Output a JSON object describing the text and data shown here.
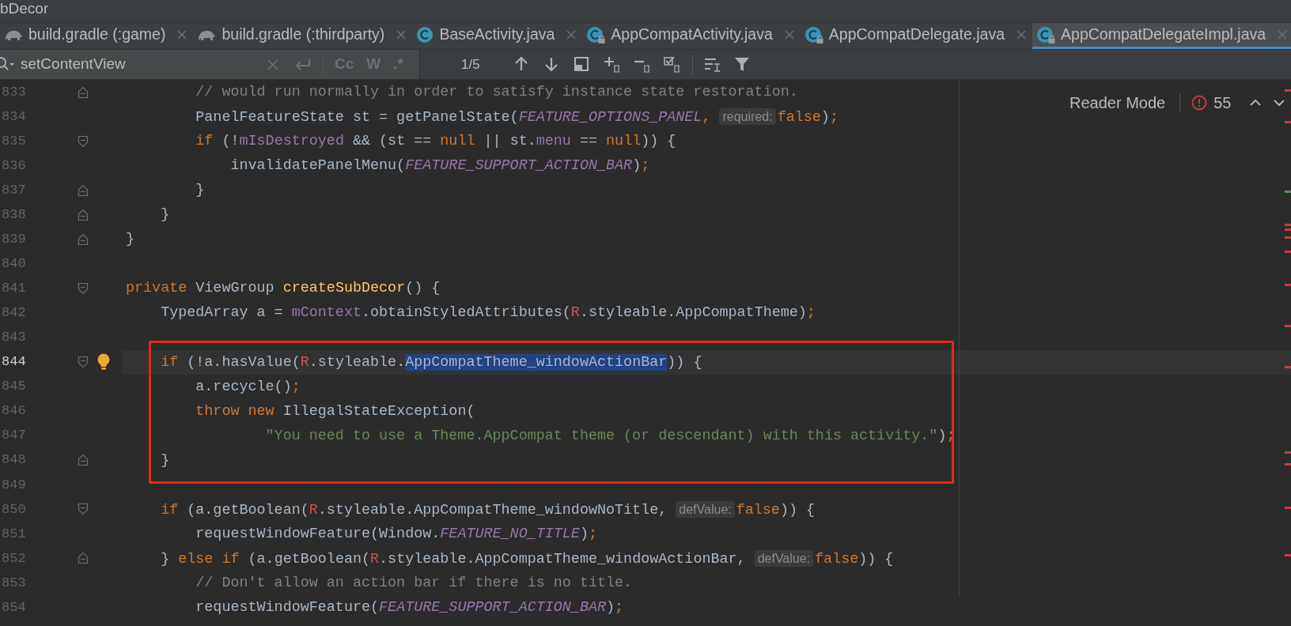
{
  "window": {
    "title": "bDecor"
  },
  "tabs": [
    {
      "label": "build.gradle (:game)",
      "kind": "gradle",
      "locked": false,
      "selected": false
    },
    {
      "label": "build.gradle (:thirdparty)",
      "kind": "gradle",
      "locked": false,
      "selected": false
    },
    {
      "label": "BaseActivity.java",
      "kind": "class",
      "locked": false,
      "selected": false
    },
    {
      "label": "AppCompatActivity.java",
      "kind": "class",
      "locked": true,
      "selected": false
    },
    {
      "label": "AppCompatDelegate.java",
      "kind": "class",
      "locked": true,
      "selected": false
    },
    {
      "label": "AppCompatDelegateImpl.java",
      "kind": "class",
      "locked": true,
      "selected": true
    }
  ],
  "search": {
    "value": "setContentView",
    "options": [
      "Cc",
      "W",
      ".*"
    ],
    "match_count": "1/5"
  },
  "reader_mode": {
    "label": "Reader Mode",
    "error_count": "55"
  },
  "editor": {
    "lines": [
      {
        "number": "833",
        "fold_start": false,
        "fold_end": true,
        "current": false,
        "bulb": false,
        "tokens": [
          {
            "kind": "comment",
            "text": "        // would run normally in order to satisfy instance state restoration."
          }
        ]
      },
      {
        "number": "834",
        "fold_start": false,
        "fold_end": false,
        "current": false,
        "bulb": false,
        "tokens": [
          {
            "kind": "plain",
            "text": "        PanelFeatureState st = getPanelState("
          },
          {
            "kind": "constant",
            "text": "FEATURE_OPTIONS_PANEL"
          },
          {
            "kind": "keyword",
            "text": ", "
          },
          {
            "kind": "hint",
            "text": "required:"
          },
          {
            "kind": "keyword",
            "text": "false"
          },
          {
            "kind": "plain",
            "text": ")"
          },
          {
            "kind": "keyword",
            "text": ";"
          }
        ]
      },
      {
        "number": "835",
        "fold_start": true,
        "fold_end": false,
        "current": false,
        "bulb": false,
        "tokens": [
          {
            "kind": "keyword",
            "text": "        if"
          },
          {
            "kind": "plain",
            "text": " (!"
          },
          {
            "kind": "field",
            "text": "mIsDestroyed"
          },
          {
            "kind": "plain",
            "text": " && (st == "
          },
          {
            "kind": "keyword",
            "text": "null"
          },
          {
            "kind": "plain",
            "text": " || st."
          },
          {
            "kind": "field",
            "text": "menu"
          },
          {
            "kind": "plain",
            "text": " == "
          },
          {
            "kind": "keyword",
            "text": "null"
          },
          {
            "kind": "plain",
            "text": ")) {"
          }
        ]
      },
      {
        "number": "836",
        "fold_start": false,
        "fold_end": false,
        "current": false,
        "bulb": false,
        "tokens": [
          {
            "kind": "plain",
            "text": "            invalidatePanelMenu("
          },
          {
            "kind": "constant",
            "text": "FEATURE_SUPPORT_ACTION_BAR"
          },
          {
            "kind": "plain",
            "text": ")"
          },
          {
            "kind": "keyword",
            "text": ";"
          }
        ]
      },
      {
        "number": "837",
        "fold_start": false,
        "fold_end": true,
        "current": false,
        "bulb": false,
        "tokens": [
          {
            "kind": "plain",
            "text": "        }"
          }
        ]
      },
      {
        "number": "838",
        "fold_start": false,
        "fold_end": true,
        "current": false,
        "bulb": false,
        "tokens": [
          {
            "kind": "plain",
            "text": "    }"
          }
        ]
      },
      {
        "number": "839",
        "fold_start": false,
        "fold_end": true,
        "current": false,
        "bulb": false,
        "tokens": [
          {
            "kind": "plain",
            "text": "}"
          }
        ]
      },
      {
        "number": "840",
        "fold_start": false,
        "fold_end": false,
        "current": false,
        "bulb": false
      },
      {
        "number": "841",
        "fold_start": true,
        "fold_end": false,
        "current": false,
        "bulb": false,
        "tokens": [
          {
            "kind": "keyword",
            "text": "private"
          },
          {
            "kind": "plain",
            "text": " ViewGroup "
          },
          {
            "kind": "method",
            "text": "createSubDecor"
          },
          {
            "kind": "plain",
            "text": "() {"
          }
        ]
      },
      {
        "number": "842",
        "fold_start": false,
        "fold_end": false,
        "current": false,
        "bulb": false,
        "tokens": [
          {
            "kind": "plain",
            "text": "    TypedArray a = "
          },
          {
            "kind": "field",
            "text": "mContext"
          },
          {
            "kind": "plain",
            "text": ".obtainStyledAttributes("
          },
          {
            "kind": "resource",
            "text": "R"
          },
          {
            "kind": "plain",
            "text": ".styleable.AppCompatTheme)"
          },
          {
            "kind": "keyword",
            "text": ";"
          }
        ]
      },
      {
        "number": "843",
        "fold_start": false,
        "fold_end": false,
        "current": false,
        "bulb": false
      },
      {
        "number": "844",
        "fold_start": true,
        "fold_end": false,
        "current": true,
        "bulb": true,
        "tokens": [
          {
            "kind": "keyword",
            "text": "    if"
          },
          {
            "kind": "plain",
            "text": " (!a.hasValue("
          },
          {
            "kind": "resource",
            "text": "R"
          },
          {
            "kind": "plain",
            "text": ".styleable."
          },
          {
            "kind": "selected",
            "text": "AppCompatTheme_windowActionBar"
          },
          {
            "kind": "plain",
            "text": ")) {"
          }
        ]
      },
      {
        "number": "845",
        "fold_start": false,
        "fold_end": false,
        "current": false,
        "bulb": false,
        "tokens": [
          {
            "kind": "plain",
            "text": "        a.recycle()"
          },
          {
            "kind": "keyword",
            "text": ";"
          }
        ]
      },
      {
        "number": "846",
        "fold_start": false,
        "fold_end": false,
        "current": false,
        "bulb": false,
        "tokens": [
          {
            "kind": "keyword",
            "text": "        throw new"
          },
          {
            "kind": "plain",
            "text": " IllegalStateException("
          }
        ]
      },
      {
        "number": "847",
        "fold_start": false,
        "fold_end": false,
        "current": false,
        "bulb": false,
        "tokens": [
          {
            "kind": "string",
            "text": "                \"You need to use a Theme.AppCompat theme (or descendant) with this activity.\""
          },
          {
            "kind": "plain",
            "text": ")"
          },
          {
            "kind": "keyword",
            "text": ";"
          }
        ]
      },
      {
        "number": "848",
        "fold_start": false,
        "fold_end": true,
        "current": false,
        "bulb": false,
        "tokens": [
          {
            "kind": "plain",
            "text": "    }"
          }
        ]
      },
      {
        "number": "849",
        "fold_start": false,
        "fold_end": false,
        "current": false,
        "bulb": false
      },
      {
        "number": "850",
        "fold_start": true,
        "fold_end": false,
        "current": false,
        "bulb": false,
        "tokens": [
          {
            "kind": "keyword",
            "text": "    if"
          },
          {
            "kind": "plain",
            "text": " (a.getBoolean("
          },
          {
            "kind": "resource",
            "text": "R"
          },
          {
            "kind": "plain",
            "text": ".styleable.AppCompatTheme_windowNoTitle, "
          },
          {
            "kind": "hint",
            "text": "defValue:"
          },
          {
            "kind": "keyword",
            "text": "false"
          },
          {
            "kind": "plain",
            "text": ")) {"
          }
        ]
      },
      {
        "number": "851",
        "fold_start": false,
        "fold_end": false,
        "current": false,
        "bulb": false,
        "tokens": [
          {
            "kind": "plain",
            "text": "        requestWindowFeature(Window."
          },
          {
            "kind": "constant",
            "text": "FEATURE_NO_TITLE"
          },
          {
            "kind": "plain",
            "text": ")"
          },
          {
            "kind": "keyword",
            "text": ";"
          }
        ]
      },
      {
        "number": "852",
        "fold_start": false,
        "fold_end": true,
        "current": false,
        "bulb": false,
        "tokens": [
          {
            "kind": "plain",
            "text": "    } "
          },
          {
            "kind": "keyword",
            "text": "else if"
          },
          {
            "kind": "plain",
            "text": " (a.getBoolean("
          },
          {
            "kind": "resource",
            "text": "R"
          },
          {
            "kind": "plain",
            "text": ".styleable.AppCompatTheme_windowActionBar, "
          },
          {
            "kind": "hint",
            "text": "defValue:"
          },
          {
            "kind": "keyword",
            "text": "false"
          },
          {
            "kind": "plain",
            "text": ")) {"
          }
        ]
      },
      {
        "number": "853",
        "fold_start": false,
        "fold_end": false,
        "current": false,
        "bulb": false,
        "tokens": [
          {
            "kind": "comment",
            "text": "        // Don't allow an action bar if there is no title."
          }
        ]
      },
      {
        "number": "854",
        "fold_start": false,
        "fold_end": false,
        "current": false,
        "bulb": false,
        "tokens": [
          {
            "kind": "plain",
            "text": "        requestWindowFeature("
          },
          {
            "kind": "constant",
            "text": "FEATURE_SUPPORT_ACTION_BAR"
          },
          {
            "kind": "plain",
            "text": ")"
          },
          {
            "kind": "keyword",
            "text": ";"
          }
        ]
      }
    ]
  }
}
